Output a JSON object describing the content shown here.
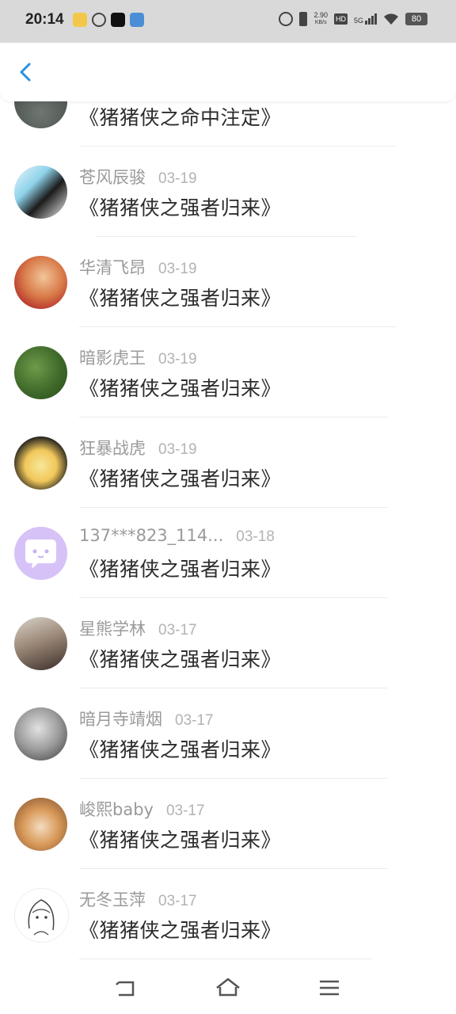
{
  "status_bar": {
    "time": "20:14",
    "net_speed_value": "2.90",
    "net_speed_unit": "KB/s",
    "hd_label": "HD",
    "net_type": "5G",
    "battery": "80"
  },
  "header": {
    "back_icon": "chevron-left-icon",
    "accent": "#2a90e0"
  },
  "comments": [
    {
      "name": "",
      "date": "",
      "text": "《猪猪侠之命中注定》"
    },
    {
      "name": "苍风辰骏",
      "date": "03-19",
      "text": "《猪猪侠之强者归来》"
    },
    {
      "name": "华清飞昂",
      "date": "03-19",
      "text": "《猪猪侠之强者归来》"
    },
    {
      "name": "暗影虎王",
      "date": "03-19",
      "text": "《猪猪侠之强者归来》"
    },
    {
      "name": "狂暴战虎",
      "date": "03-19",
      "text": "《猪猪侠之强者归来》"
    },
    {
      "name": "137***823_114...",
      "date": "03-18",
      "text": "《猪猪侠之强者归来》"
    },
    {
      "name": "星熊学林",
      "date": "03-17",
      "text": "《猪猪侠之强者归来》"
    },
    {
      "name": "暗月寺靖烟",
      "date": "03-17",
      "text": "《猪猪侠之强者归来》"
    },
    {
      "name": "峻熙baby",
      "date": "03-17",
      "text": "《猪猪侠之强者归来》"
    },
    {
      "name": "无冬玉萍",
      "date": "03-17",
      "text": "《猪猪侠之强者归来》"
    }
  ],
  "nav": {
    "back": "nav-back-icon",
    "home": "home-icon",
    "menu": "menu-icon"
  }
}
